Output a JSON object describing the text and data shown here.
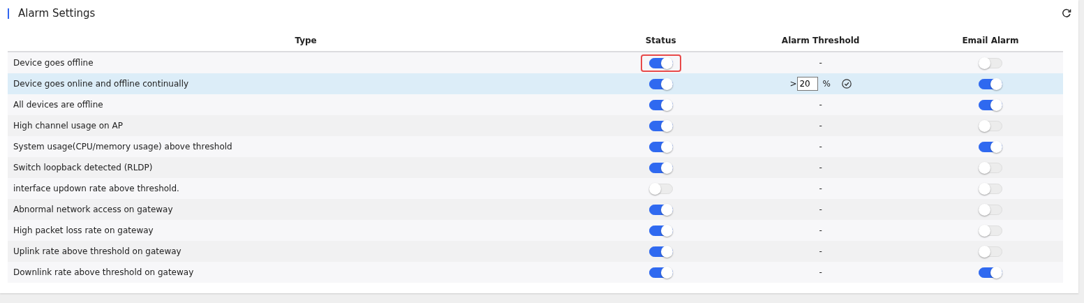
{
  "panel": {
    "title": "Alarm Settings"
  },
  "table": {
    "columns": [
      "Type",
      "Status",
      "Alarm Threshold",
      "Email Alarm"
    ],
    "rows": [
      {
        "type": "Device goes offline",
        "status_on": true,
        "status_focused": true,
        "threshold": {
          "kind": "text",
          "text": "-"
        },
        "email_on": false,
        "selected": false
      },
      {
        "type": "Device goes online and offline continually",
        "status_on": true,
        "status_focused": false,
        "threshold": {
          "kind": "input",
          "prefix": ">",
          "value": "20",
          "unit": "%"
        },
        "email_on": true,
        "selected": true
      },
      {
        "type": "All devices are offline",
        "status_on": true,
        "status_focused": false,
        "threshold": {
          "kind": "text",
          "text": "-"
        },
        "email_on": true,
        "selected": false
      },
      {
        "type": "High channel usage on AP",
        "status_on": true,
        "status_focused": false,
        "threshold": {
          "kind": "text",
          "text": "-"
        },
        "email_on": false,
        "selected": false
      },
      {
        "type": "System usage(CPU/memory usage) above threshold",
        "status_on": true,
        "status_focused": false,
        "threshold": {
          "kind": "text",
          "text": "-"
        },
        "email_on": true,
        "selected": false
      },
      {
        "type": "Switch loopback detected (RLDP)",
        "status_on": true,
        "status_focused": false,
        "threshold": {
          "kind": "text",
          "text": "-"
        },
        "email_on": false,
        "selected": false
      },
      {
        "type": "interface updown rate above threshold.",
        "status_on": false,
        "status_focused": false,
        "threshold": {
          "kind": "text",
          "text": "-"
        },
        "email_on": false,
        "selected": false
      },
      {
        "type": "Abnormal network access on gateway",
        "status_on": true,
        "status_focused": false,
        "threshold": {
          "kind": "text",
          "text": "-"
        },
        "email_on": false,
        "selected": false
      },
      {
        "type": "High packet loss rate on gateway",
        "status_on": true,
        "status_focused": false,
        "threshold": {
          "kind": "text",
          "text": "-"
        },
        "email_on": false,
        "selected": false
      },
      {
        "type": "Uplink rate above threshold on gateway",
        "status_on": true,
        "status_focused": false,
        "threshold": {
          "kind": "text",
          "text": "-"
        },
        "email_on": false,
        "selected": false
      },
      {
        "type": "Downlink rate above threshold on gateway",
        "status_on": true,
        "status_focused": false,
        "threshold": {
          "kind": "text",
          "text": "-"
        },
        "email_on": true,
        "selected": false
      }
    ]
  }
}
